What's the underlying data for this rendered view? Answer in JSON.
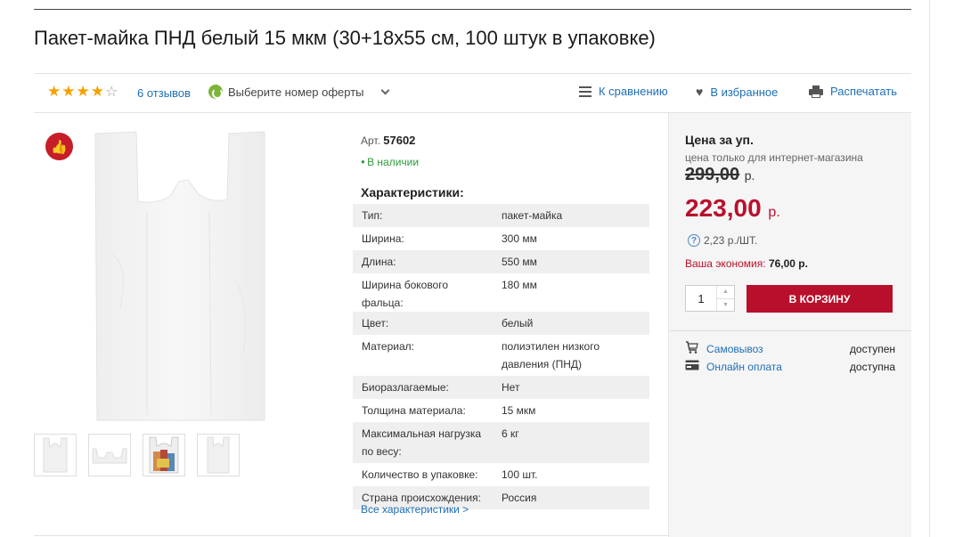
{
  "product": {
    "title": "Пакет-майка ПНД белый 15 мкм (30+18х55 см, 100 штук в упаковке)"
  },
  "toolbar": {
    "rating": 4,
    "rating_max": 5,
    "reviews": "6 отзывов",
    "offer_select": "Выберите номер оферты",
    "compare": "К сравнению",
    "favorites": "В избранное",
    "print": "Распечатать"
  },
  "main": {
    "article_label": "Арт.",
    "article_number": "57602",
    "stock": "В наличии",
    "specs_title": "Характеристики:",
    "specs": [
      {
        "name": "Тип:",
        "value": "пакет-майка"
      },
      {
        "name": "Ширина:",
        "value": "300  мм"
      },
      {
        "name": "Длина:",
        "value": "550  мм"
      },
      {
        "name": "Ширина бокового фальца:",
        "value": "180  мм"
      },
      {
        "name": "Цвет:",
        "value": "белый"
      },
      {
        "name": "Материал:",
        "value": "полиэтилен низкого давления (ПНД)"
      },
      {
        "name": "Биоразлагаемые:",
        "value": "Нет"
      },
      {
        "name": "Толщина материала:",
        "value": "15  мкм"
      },
      {
        "name": "Максимальная нагрузка по весу:",
        "value": "6  кг"
      },
      {
        "name": "Количество в упаковке:",
        "value": "100  шт."
      },
      {
        "name": "Страна происхождения:",
        "value": "Россия"
      }
    ],
    "all_specs_link": "Все характеристики >"
  },
  "buy": {
    "price_heading": "Цена за уп.",
    "price_note": "цена только для интернет-магазина",
    "old_price": "299,00",
    "new_price": "223,00",
    "currency": "р.",
    "unit_price": "2,23 р./ШТ.",
    "savings_label": "Ваша экономия:",
    "savings_value": "76,00 р.",
    "quantity": "1",
    "cart_button": "В КОРЗИНУ",
    "delivery": [
      {
        "label": "Самовывоз",
        "value": "доступен",
        "icon": "cart-icon"
      },
      {
        "label": "Онлайн оплата",
        "value": "доступна",
        "icon": "card-icon"
      }
    ]
  },
  "colors": {
    "accent": "#b8102c",
    "link": "#1e6fb5",
    "star": "#f5a000",
    "in_stock": "#2e9a3a"
  }
}
